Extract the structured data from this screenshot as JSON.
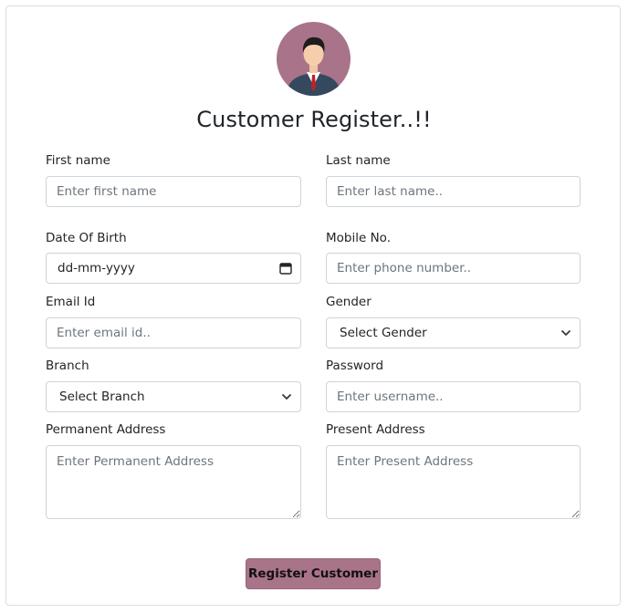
{
  "form": {
    "title": "Customer Register..!!",
    "first_name": {
      "label": "First name",
      "placeholder": "Enter first name"
    },
    "last_name": {
      "label": "Last name",
      "placeholder": "Enter last name.."
    },
    "dob": {
      "label": "Date Of Birth",
      "placeholder": "dd-mm-yyyy",
      "icon": "calendar-icon"
    },
    "mobile": {
      "label": "Mobile No.",
      "placeholder": "Enter phone number.."
    },
    "email": {
      "label": "Email Id",
      "placeholder": "Enter email id.."
    },
    "gender": {
      "label": "Gender",
      "selected": "Select Gender",
      "icon": "chevron-down-icon"
    },
    "branch": {
      "label": "Branch",
      "selected": "Select Branch",
      "icon": "chevron-down-icon"
    },
    "password": {
      "label": "Password",
      "placeholder": "Enter username.."
    },
    "permanent_address": {
      "label": "Permanent Address",
      "placeholder": "Enter Permanent Address"
    },
    "present_address": {
      "label": "Present Address",
      "placeholder": "Enter Present Address"
    },
    "submit_label": "Register Customer"
  },
  "colors": {
    "accent": "#a97389",
    "avatar_bg": "#a97389",
    "border": "#ced4da",
    "text": "#212529",
    "placeholder": "#6c757d"
  },
  "avatar": {
    "icon": "user-avatar-icon"
  }
}
